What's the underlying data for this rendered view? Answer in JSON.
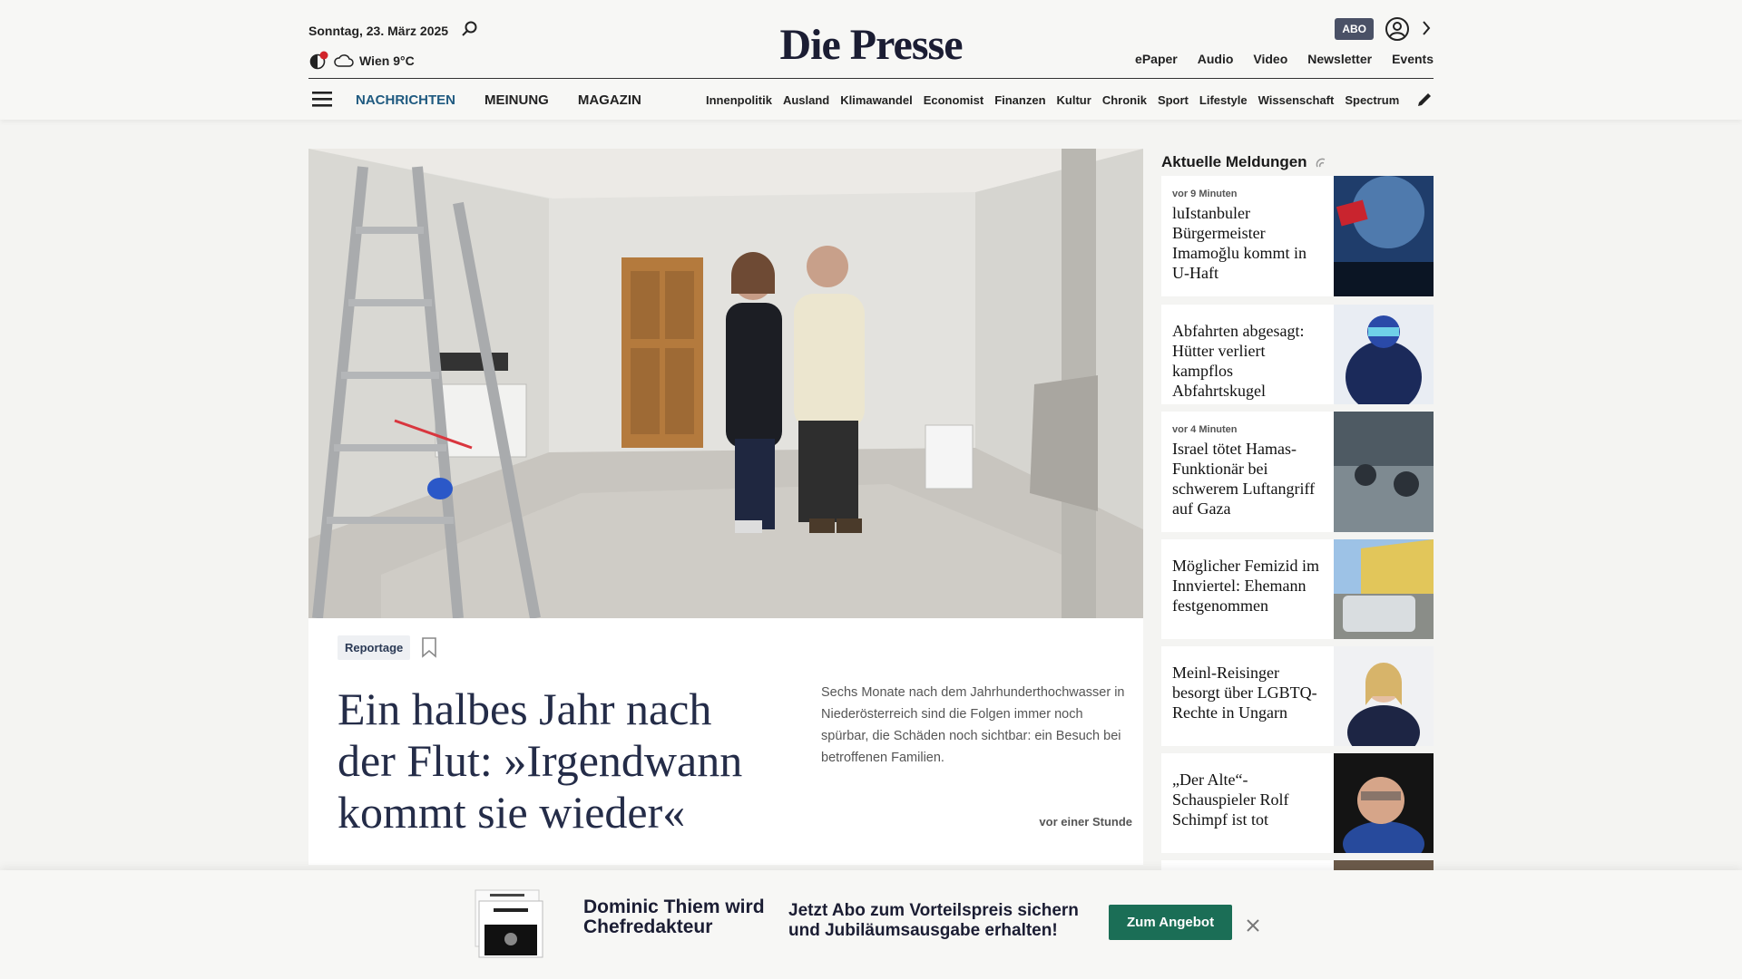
{
  "header": {
    "date": "Sonntag, 23. März 2025",
    "weather": "Wien 9°C",
    "logo": "Die Presse",
    "abo_label": "ABO",
    "top_links": [
      "ePaper",
      "Audio",
      "Video",
      "Newsletter",
      "Events"
    ],
    "main_nav": [
      {
        "label": "NACHRICHTEN",
        "active": true
      },
      {
        "label": "MEINUNG",
        "active": false
      },
      {
        "label": "MAGAZIN",
        "active": false
      }
    ],
    "sub_nav": [
      "Innenpolitik",
      "Ausland",
      "Klimawandel",
      "Economist",
      "Finanzen",
      "Kultur",
      "Chronik",
      "Sport",
      "Lifestyle",
      "Wissenschaft",
      "Spectrum"
    ]
  },
  "hero": {
    "tag": "Reportage",
    "headline": "Ein halbes Jahr nach der Flut: »Irgendwann kommt sie wieder«",
    "teaser": "Sechs Monate nach dem Jahrhunderthochwasser in Niederösterreich sind die Folgen immer noch spürbar, die Schäden noch sichtbar: ein Besuch bei betroffenen Familien.",
    "time": "vor einer Stunde"
  },
  "sidebar": {
    "title": "Aktuelle Meldungen",
    "items": [
      {
        "time": "vor 9 Minuten",
        "title": "luIstanbuler Bürgermeister Imamoğlu kommt in U-Haft"
      },
      {
        "time": "",
        "title": "Abfahrten abgesagt: Hütter verliert kampflos Abfahrtskugel"
      },
      {
        "time": "vor 4 Minuten",
        "title": "Israel tötet Hamas-Funktionär bei schwerem Luftangriff auf Gaza"
      },
      {
        "time": "",
        "title": "Möglicher Femizid im Innviertel: Ehemann festgenommen"
      },
      {
        "time": "",
        "title": "Meinl-Reisinger besorgt über LGBTQ-Rechte in Ungarn"
      },
      {
        "time": "",
        "title": "„Der Alte“-Schauspieler Rolf Schimpf ist tot"
      }
    ]
  },
  "banner": {
    "headline1": "Dominic Thiem wird Chefredakteur",
    "headline2": "Jetzt Abo zum Vorteilspreis sichern und Jubiläumsausgabe erhalten!",
    "cta": "Zum Angebot"
  },
  "colors": {
    "brand": "#1b1d33",
    "nav_active": "#1f5a80",
    "cta": "#1b6e56",
    "abo_badge": "#4a5166"
  }
}
